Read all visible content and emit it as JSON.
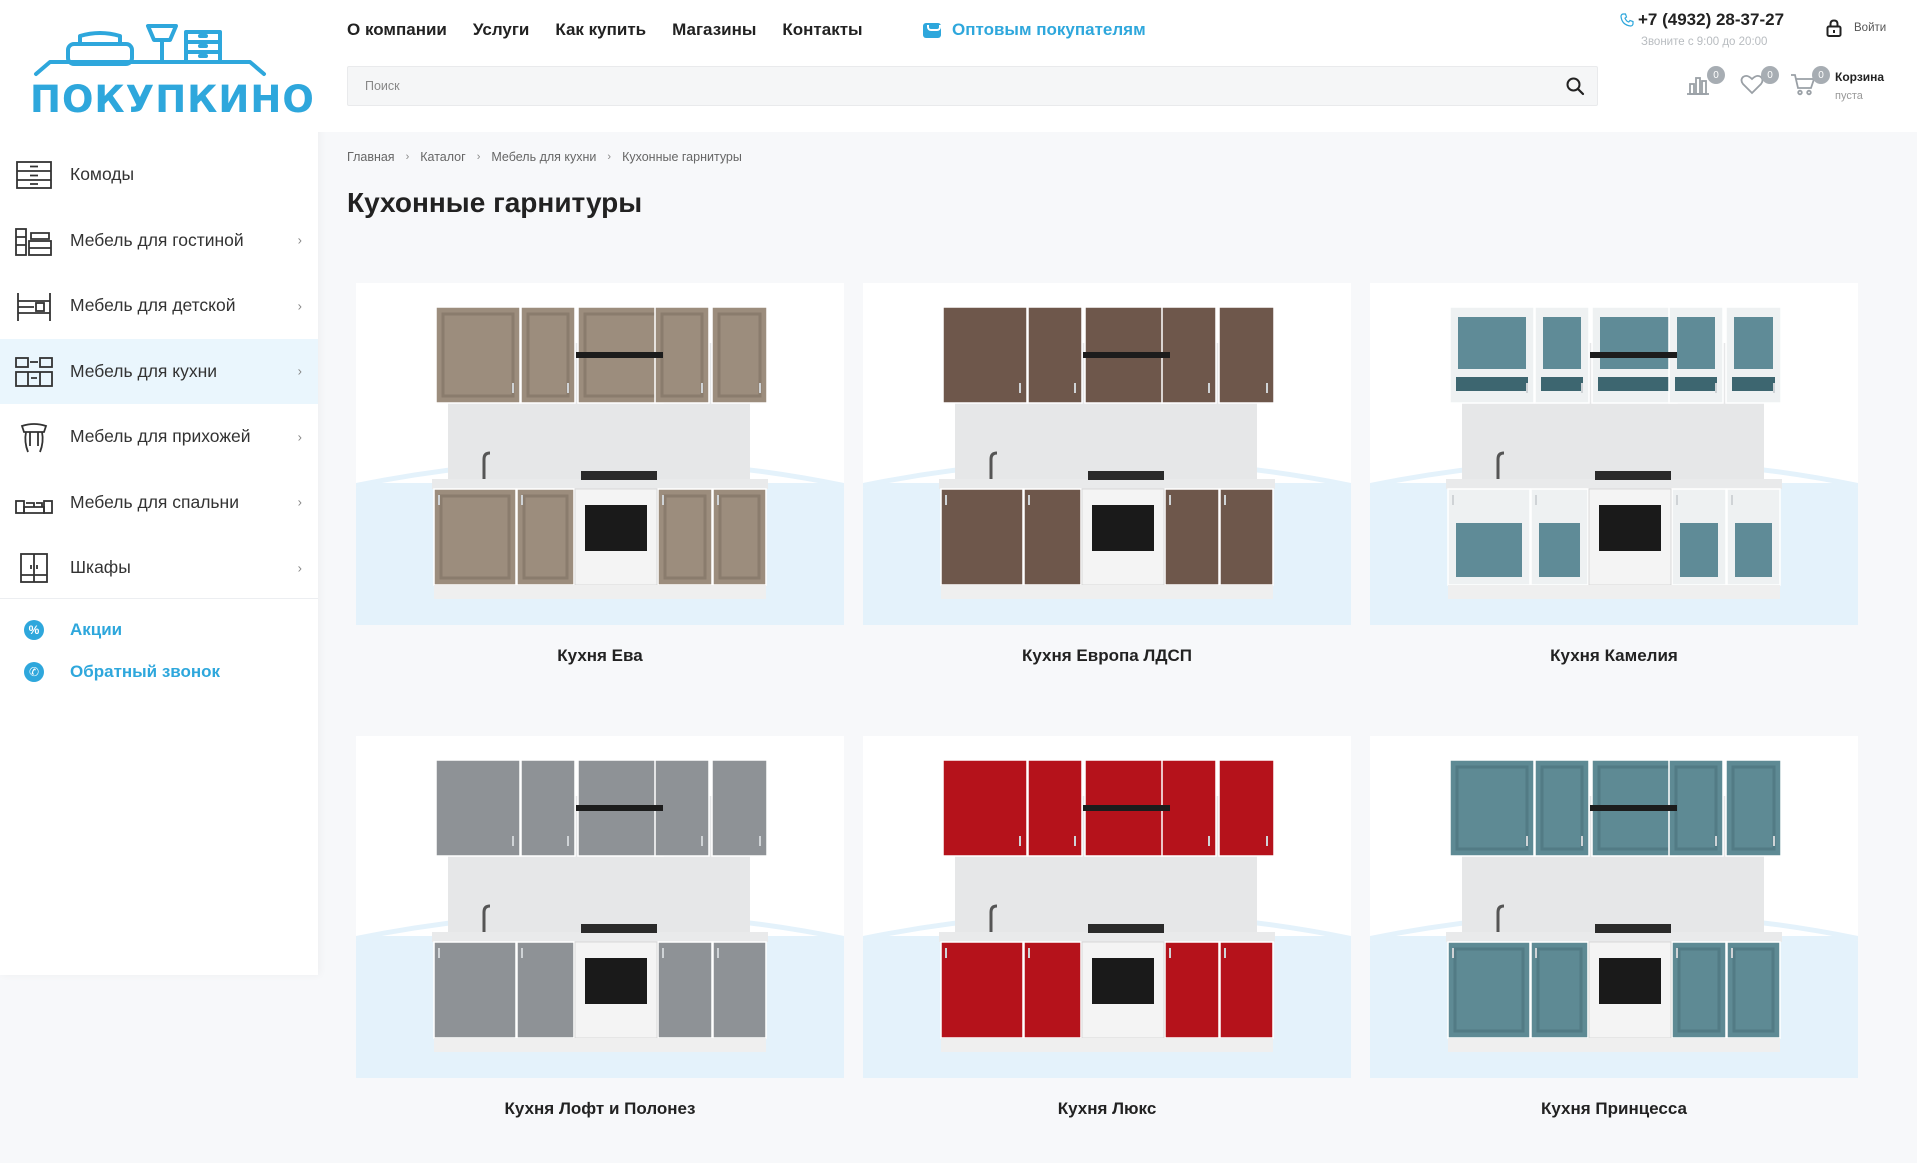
{
  "logo": {
    "text": "ПОКУПКИНО"
  },
  "sidebar": {
    "items": [
      {
        "label": "Комоды",
        "icon": "dresser-icon",
        "has_arrow": false
      },
      {
        "label": "Мебель для гостиной",
        "icon": "living-room-icon",
        "has_arrow": true
      },
      {
        "label": "Мебель для детской",
        "icon": "bunk-bed-icon",
        "has_arrow": true
      },
      {
        "label": "Мебель для кухни",
        "icon": "kitchen-icon",
        "has_arrow": true,
        "active": true
      },
      {
        "label": "Мебель для прихожей",
        "icon": "hallway-icon",
        "has_arrow": true
      },
      {
        "label": "Мебель для спальни",
        "icon": "bed-icon",
        "has_arrow": true
      },
      {
        "label": "Шкафы",
        "icon": "wardrobe-icon",
        "has_arrow": true
      }
    ],
    "promo": [
      {
        "label": "Акции",
        "icon": "percent-icon"
      },
      {
        "label": "Обратный звонок",
        "icon": "phone-icon"
      }
    ]
  },
  "header": {
    "nav": [
      "О компании",
      "Услуги",
      "Как купить",
      "Магазины",
      "Контакты"
    ],
    "wholesale": "Оптовым покупателям",
    "phone": "+7 (4932) 28-37-27",
    "phone_note": "Звоните с 9:00 до 20:00",
    "login": "Войти",
    "search_placeholder": "Поиск",
    "compare_count": "0",
    "favorites_count": "0",
    "cart_count": "0",
    "cart_title": "Корзина",
    "cart_sub": "пуста"
  },
  "breadcrumbs": [
    "Главная",
    "Каталог",
    "Мебель для кухни",
    "Кухонные гарнитуры"
  ],
  "page_title": "Кухонные гарнитуры",
  "products": [
    {
      "name": "Кухня Ева",
      "finish": "framed",
      "color": "#9c8d7d",
      "accent": "#8a7c6d"
    },
    {
      "name": "Кухня Европа ЛДСП",
      "finish": "wood",
      "color": "#6e574b",
      "accent": "#5e4a40"
    },
    {
      "name": "Кухня Камелия",
      "finish": "glass",
      "color": "#5f8b97",
      "accent": "#e8ecee"
    },
    {
      "name": "Кухня Лофт и Полонез",
      "finish": "concrete",
      "color": "#8e9296",
      "accent": "#9aaab7"
    },
    {
      "name": "Кухня Люкс",
      "finish": "gloss",
      "color": "#b5121b",
      "accent": "#9d0f17"
    },
    {
      "name": "Кухня Принцесса",
      "finish": "framed",
      "color": "#5e8a94",
      "accent": "#527b85"
    }
  ],
  "colors": {
    "accent": "#2ea7dc",
    "active_bg": "#eaf6fd"
  }
}
